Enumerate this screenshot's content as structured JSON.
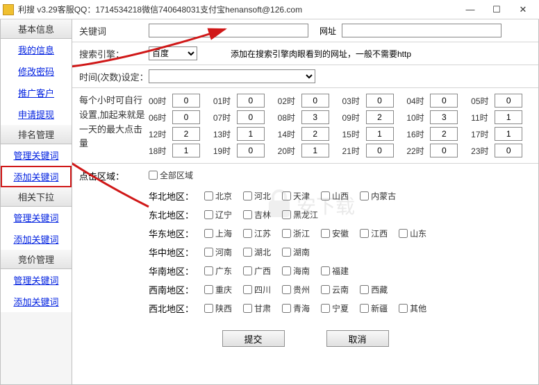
{
  "window": {
    "title": "利搜 v3.29客服QQ：1714534218微信740648031支付宝henansoft@126.com"
  },
  "sidebar": {
    "sections": [
      {
        "header": "基本信息",
        "items": [
          "我的信息",
          "修改密码",
          "推广客户",
          "申请提现"
        ]
      },
      {
        "header": "排名管理",
        "items": [
          "管理关键词",
          "添加关键词"
        ]
      },
      {
        "header": "相关下拉",
        "items": [
          "管理关键词",
          "添加关键词"
        ]
      },
      {
        "header": "竞价管理",
        "items": [
          "管理关键词",
          "添加关键词"
        ]
      }
    ]
  },
  "form": {
    "keyword_label": "关键词",
    "url_label": "网址",
    "engine_label": "搜索引擎：",
    "engine_value": "百度",
    "engine_hint": "添加在搜索引擎肉眼看到的网址，一般不需要http",
    "time_label": "时间(次数)设定：",
    "hourly_label": "每个小时可自行设置,加起来就是一天的最大点击量",
    "hours": [
      {
        "l": "00时",
        "v": "0"
      },
      {
        "l": "01时",
        "v": "0"
      },
      {
        "l": "02时",
        "v": "0"
      },
      {
        "l": "03时",
        "v": "0"
      },
      {
        "l": "04时",
        "v": "0"
      },
      {
        "l": "05时",
        "v": "0"
      },
      {
        "l": "06时",
        "v": "0"
      },
      {
        "l": "07时",
        "v": "0"
      },
      {
        "l": "08时",
        "v": "3"
      },
      {
        "l": "09时",
        "v": "2"
      },
      {
        "l": "10时",
        "v": "3"
      },
      {
        "l": "11时",
        "v": "1"
      },
      {
        "l": "12时",
        "v": "2"
      },
      {
        "l": "13时",
        "v": "1"
      },
      {
        "l": "14时",
        "v": "2"
      },
      {
        "l": "15时",
        "v": "1"
      },
      {
        "l": "16时",
        "v": "2"
      },
      {
        "l": "17时",
        "v": "1"
      },
      {
        "l": "18时",
        "v": "1"
      },
      {
        "l": "19时",
        "v": "0"
      },
      {
        "l": "20时",
        "v": "1"
      },
      {
        "l": "21时",
        "v": "0"
      },
      {
        "l": "22时",
        "v": "0"
      },
      {
        "l": "23时",
        "v": "0"
      }
    ],
    "region_label": "点击区域：",
    "all_regions": "全部区域",
    "region_groups": [
      {
        "name": "华北地区：",
        "opts": [
          "北京",
          "河北",
          "天津",
          "山西",
          "内蒙古"
        ]
      },
      {
        "name": "东北地区：",
        "opts": [
          "辽宁",
          "吉林",
          "黑龙江"
        ]
      },
      {
        "name": "华东地区：",
        "opts": [
          "上海",
          "江苏",
          "浙江",
          "安徽",
          "江西",
          "山东"
        ]
      },
      {
        "name": "华中地区：",
        "opts": [
          "河南",
          "湖北",
          "湖南"
        ]
      },
      {
        "name": "华南地区：",
        "opts": [
          "广东",
          "广西",
          "海南",
          "福建"
        ]
      },
      {
        "name": "西南地区：",
        "opts": [
          "重庆",
          "四川",
          "贵州",
          "云南",
          "西藏"
        ]
      },
      {
        "name": "西北地区：",
        "opts": [
          "陕西",
          "甘肃",
          "青海",
          "宁夏",
          "新疆",
          "其他"
        ]
      }
    ],
    "submit": "提交",
    "cancel": "取消"
  },
  "watermark": "安下载"
}
